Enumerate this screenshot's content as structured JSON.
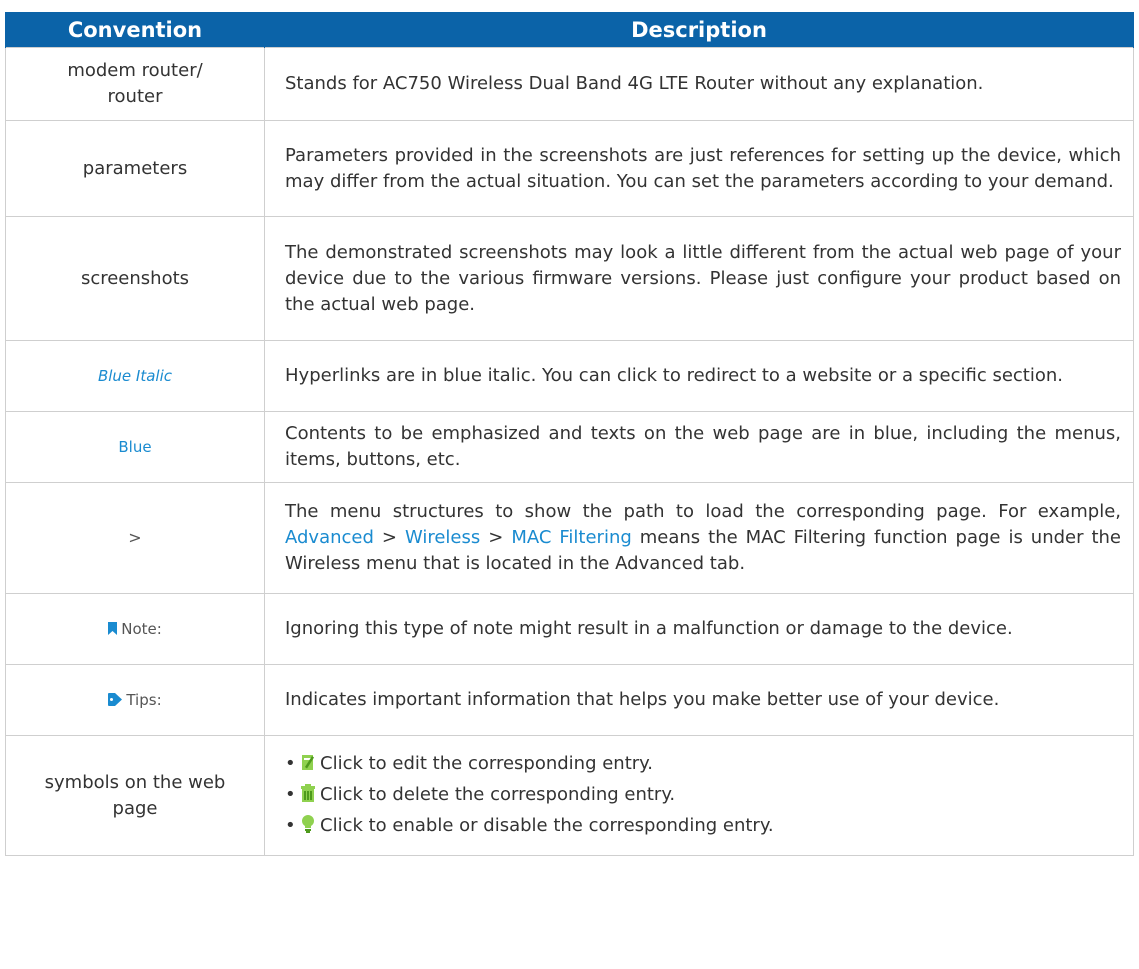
{
  "table": {
    "header_convention": "Convention",
    "header_description": "Description",
    "rows": [
      {
        "convention": "modem router/ router",
        "description": "Stands for AC750 Wireless Dual Band 4G LTE Router without any explanation."
      },
      {
        "convention": "parameters",
        "description": "Parameters provided in the screenshots are just references for setting up the device, which may differ from the actual situation. You can set the parameters according to your demand."
      },
      {
        "convention": "screenshots",
        "description": "The demonstrated screenshots may look a little different from the actual web page of your device due to the various firmware versions. Please just configure your product based on the actual web page."
      },
      {
        "convention": "Blue Italic",
        "description": "Hyperlinks are in blue italic. You can click to redirect to a website or a specific section."
      },
      {
        "convention": "Blue",
        "description": "Contents to be emphasized and texts on the web page are in blue, including the menus, items, buttons, etc."
      },
      {
        "convention": ">",
        "description_pre": "The menu structures to show the path to load the corresponding page. For example,",
        "path_advanced": "Advanced",
        "path_sep": ">",
        "path_wireless": "Wireless",
        "path_mac": "MAC Filtering",
        "description_post": "means the MAC Filtering function page is under the Wireless menu that is located in the Advanced tab."
      },
      {
        "convention": "Note:",
        "description": "Ignoring this type of note might result in a malfunction or damage to the device."
      },
      {
        "convention": "Tips:",
        "description": "Indicates important information that helps you make better use of your device."
      },
      {
        "convention": "symbols on the web page",
        "items": [
          {
            "icon": "edit-icon",
            "text": "Click to edit the corresponding entry."
          },
          {
            "icon": "delete-icon",
            "text": "Click to delete the corresponding entry."
          },
          {
            "icon": "enable-icon",
            "text": "Click to enable or disable the corresponding entry."
          }
        ]
      }
    ]
  },
  "colors": {
    "header_bg": "#0b63a8",
    "link_blue": "#1a8bd0",
    "border": "#cfcfcf"
  }
}
